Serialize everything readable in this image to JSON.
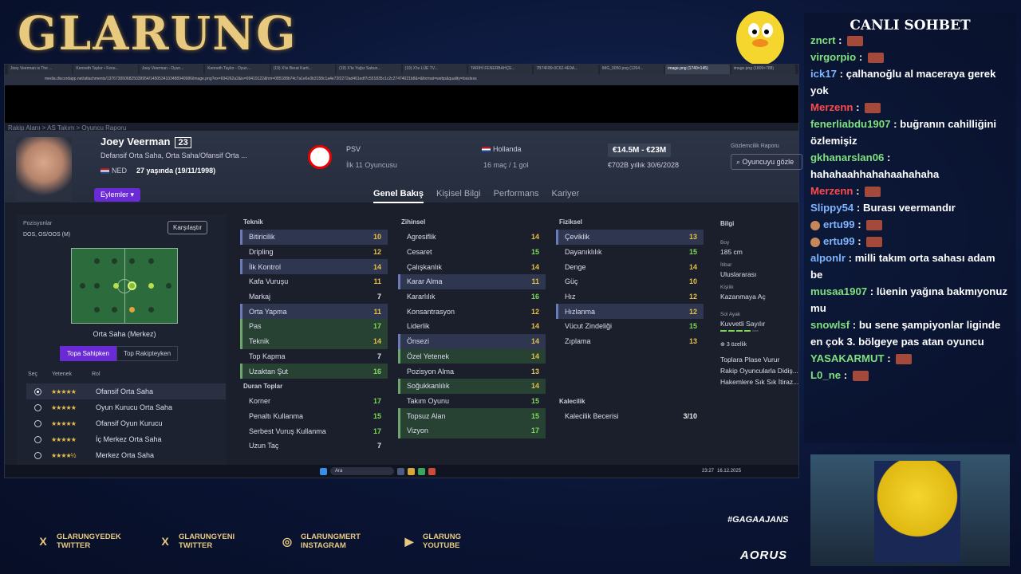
{
  "stream": {
    "brand": "GLARUNG",
    "hashtag": "#GAGAAJANS",
    "aorus": "AORUS"
  },
  "browser": {
    "tabs": [
      "Joey Veerman is The ...",
      "Kenneth Taylor • Fene...",
      "Joey Veerman - Oyun...",
      "Kenneth Taylor - Oyun...",
      "(19) X'te Berat Kartt...",
      "(19) X'te Yağız Sabun...",
      "(19) X'te LÜE TV...",
      "TARİHİ FENERBAHÇE...",
      "7B74F89-0C62-4E9A...",
      "IMG_0050.png (1264...",
      "image.png (1740×145)",
      "image.png (1809×788)"
    ],
    "address": "media.discordapp.net/attachments/1376730506825039954/1450534103488940986/image.png?ex=694262a2&is=69419122&hm=085188b74c7a1e6e3b3158c1a4e72f2272ad461edf7c551835c1c2c27474021b8&=&format=webp&quality=lossless"
  },
  "fm": {
    "breadcrumb": "Rakip Alanı  >  AS Takım  >  Oyuncu Raporu",
    "player": {
      "name": "Joey Veerman",
      "number": "23",
      "positions": "Defansif Orta Saha, Orta Saha/Ofansif Orta ...",
      "nation": "NED",
      "age": "27 yaşında (19/11/1998)"
    },
    "actions": "Eylemler",
    "club": {
      "name": "PSV",
      "sub": "İlk 11 Oyuncusu"
    },
    "country": {
      "name": "Hollanda",
      "sub": "16 maç / 1 gol"
    },
    "value": "€14.5M - €23M",
    "wage": "€702B yıllık 30/6/2028",
    "scout": {
      "label": "Gözlemcilik Raporu",
      "button": "Oyuncuyu gözle"
    },
    "tabs": [
      "Genel Bakış",
      "Kişisel Bilgi",
      "Performans",
      "Kariyer"
    ],
    "left": {
      "positions_label": "Pozisyonlar",
      "positions_value": "DOS, OS/OOS (M)",
      "compare": "Karşılaştır",
      "pitch_caption": "Orta Saha (Merkez)",
      "toggle_on": "Topa Sahipken",
      "toggle_off": "Top Rakipteyken",
      "hdr_sec": "Seç",
      "hdr_yetenek": "Yetenek",
      "hdr_rol": "Rol",
      "roles": [
        {
          "name": "Ofansif Orta Saha",
          "stars": "★★★★★",
          "selected": true
        },
        {
          "name": "Oyun Kurucu Orta Saha",
          "stars": "★★★★★",
          "selected": false
        },
        {
          "name": "Ofansif Oyun Kurucu",
          "stars": "★★★★★",
          "selected": false
        },
        {
          "name": "İç Merkez Orta Saha",
          "stars": "★★★★★",
          "selected": false
        },
        {
          "name": "Merkez Orta Saha",
          "stars": "★★★★½",
          "selected": false
        }
      ]
    },
    "teknik": {
      "title": "Teknik",
      "items": [
        {
          "n": "Bitiricilik",
          "v": "10",
          "s": "md",
          "c": "hl"
        },
        {
          "n": "Dripling",
          "v": "12",
          "s": "md",
          "c": ""
        },
        {
          "n": "İlk Kontrol",
          "v": "14",
          "s": "md",
          "c": "hl"
        },
        {
          "n": "Kafa Vuruşu",
          "v": "11",
          "s": "md",
          "c": ""
        },
        {
          "n": "Markaj",
          "v": "7",
          "s": "lo",
          "c": ""
        },
        {
          "n": "Orta Yapma",
          "v": "11",
          "s": "md",
          "c": "hl"
        },
        {
          "n": "Pas",
          "v": "17",
          "s": "hi",
          "c": "gr"
        },
        {
          "n": "Teknik",
          "v": "14",
          "s": "md",
          "c": "gr"
        },
        {
          "n": "Top Kapma",
          "v": "7",
          "s": "lo",
          "c": ""
        },
        {
          "n": "Uzaktan Şut",
          "v": "16",
          "s": "hi",
          "c": "gr"
        }
      ]
    },
    "duran": {
      "title": "Duran Toplar",
      "items": [
        {
          "n": "Korner",
          "v": "17",
          "s": "hi",
          "c": ""
        },
        {
          "n": "Penaltı Kullanma",
          "v": "15",
          "s": "hi",
          "c": ""
        },
        {
          "n": "Serbest Vuruş Kullanma",
          "v": "17",
          "s": "hi",
          "c": ""
        },
        {
          "n": "Uzun Taç",
          "v": "7",
          "s": "lo",
          "c": ""
        }
      ]
    },
    "zihinsel": {
      "title": "Zihinsel",
      "items": [
        {
          "n": "Agresiflik",
          "v": "14",
          "s": "md",
          "c": ""
        },
        {
          "n": "Cesaret",
          "v": "15",
          "s": "hi",
          "c": ""
        },
        {
          "n": "Çalışkanlık",
          "v": "14",
          "s": "md",
          "c": ""
        },
        {
          "n": "Karar Alma",
          "v": "11",
          "s": "md",
          "c": "hl"
        },
        {
          "n": "Kararlılık",
          "v": "16",
          "s": "hi",
          "c": ""
        },
        {
          "n": "Konsantrasyon",
          "v": "12",
          "s": "md",
          "c": ""
        },
        {
          "n": "Liderlik",
          "v": "14",
          "s": "md",
          "c": ""
        },
        {
          "n": "Önsezi",
          "v": "14",
          "s": "md",
          "c": "hl"
        },
        {
          "n": "Özel Yetenek",
          "v": "14",
          "s": "md",
          "c": "gr"
        },
        {
          "n": "Pozisyon Alma",
          "v": "13",
          "s": "md",
          "c": ""
        },
        {
          "n": "Soğukkanlılık",
          "v": "14",
          "s": "md",
          "c": "gr"
        },
        {
          "n": "Takım Oyunu",
          "v": "15",
          "s": "hi",
          "c": ""
        },
        {
          "n": "Topsuz Alan",
          "v": "15",
          "s": "hi",
          "c": "gr"
        },
        {
          "n": "Vizyon",
          "v": "17",
          "s": "hi",
          "c": "gr"
        }
      ]
    },
    "fiziksel": {
      "title": "Fiziksel",
      "items": [
        {
          "n": "Çeviklik",
          "v": "13",
          "s": "md",
          "c": "hl"
        },
        {
          "n": "Dayanıklılık",
          "v": "15",
          "s": "hi",
          "c": ""
        },
        {
          "n": "Denge",
          "v": "14",
          "s": "md",
          "c": ""
        },
        {
          "n": "Güç",
          "v": "10",
          "s": "md",
          "c": ""
        },
        {
          "n": "Hız",
          "v": "12",
          "s": "md",
          "c": ""
        },
        {
          "n": "Hızlanma",
          "v": "12",
          "s": "md",
          "c": "hl"
        },
        {
          "n": "Vücut Zindeliği",
          "v": "15",
          "s": "hi",
          "c": ""
        },
        {
          "n": "Zıplama",
          "v": "13",
          "s": "md",
          "c": ""
        }
      ]
    },
    "kalecilik": {
      "title": "Kalecilik",
      "item": "Kalecilik Becerisi",
      "value": "3/10"
    },
    "info": {
      "title": "Bilgi",
      "boy_l": "Boy",
      "boy": "185 cm",
      "itibar_l": "İtibar",
      "itibar": "Uluslararası",
      "kisilik_l": "Kişilik",
      "kisilik": "Kazanmaya Aç",
      "ayak_l": "Sol Ayak",
      "ayak": "Kuvvetli Sayılır",
      "ozellik": "3 özellik",
      "traits": [
        "Toplara Plase Vurur",
        "Rakip Oyuncularla Didiş...",
        "Hakemlere Sık Sık İtiraz..."
      ]
    }
  },
  "taskbar": {
    "search": "Ara",
    "time": "23:27",
    "date": "16.12.2025"
  },
  "chat": {
    "title": "CANLI SOHBET",
    "messages": [
      {
        "user": "zncrt",
        "color": "#7fe07f",
        "text": ""
      },
      {
        "user": "virgorpio",
        "color": "#7fe07f",
        "text": ""
      },
      {
        "user": "ick17",
        "color": "#7fb4ff",
        "text": "çalhanoğlu al maceraya gerek yok"
      },
      {
        "user": "Merzenn",
        "color": "#ff4a4a",
        "text": ""
      },
      {
        "user": "fenerliabdu1907",
        "color": "#7fe07f",
        "text": "buğranın cahilliğini özlemişiz"
      },
      {
        "user": "gkhanarslan06",
        "color": "#7fe07f",
        "text": "hahahaahhahahaahahaha"
      },
      {
        "user": "Merzenn",
        "color": "#ff4a4a",
        "text": ""
      },
      {
        "user": "Slippy54",
        "color": "#7fb4ff",
        "text": "Burası veermandır"
      },
      {
        "user": "ertu99",
        "color": "#7fb4ff",
        "text": ""
      },
      {
        "user": "ertu99",
        "color": "#7fb4ff",
        "text": ""
      },
      {
        "user": "alponlr",
        "color": "#7fb4ff",
        "text": "milli takım orta sahası adam be"
      },
      {
        "user": "musaa1907",
        "color": "#7fe07f",
        "text": "lüenin yağına bakmıyonuz mu"
      },
      {
        "user": "snowlsf",
        "color": "#7fe07f",
        "text": "bu sene şampiyonlar liginde en çok 3. bölgeye pas atan oyuncu"
      },
      {
        "user": "YASAKARMUT",
        "color": "#7fe07f",
        "text": ""
      },
      {
        "user": "L0_ne",
        "color": "#7fe07f",
        "text": ""
      }
    ]
  },
  "socials": [
    {
      "icon": "x-icon",
      "glyph": "X",
      "line1": "GLARUNGYEDEK",
      "line2": "TWITTER"
    },
    {
      "icon": "x-icon",
      "glyph": "X",
      "line1": "GLARUNGYENI",
      "line2": "TWITTER"
    },
    {
      "icon": "instagram-icon",
      "glyph": "◎",
      "line1": "GLARUNGMERT",
      "line2": "INSTAGRAM"
    },
    {
      "icon": "youtube-icon",
      "glyph": "▶",
      "line1": "GLARUNG",
      "line2": "YOUTUBE"
    }
  ]
}
